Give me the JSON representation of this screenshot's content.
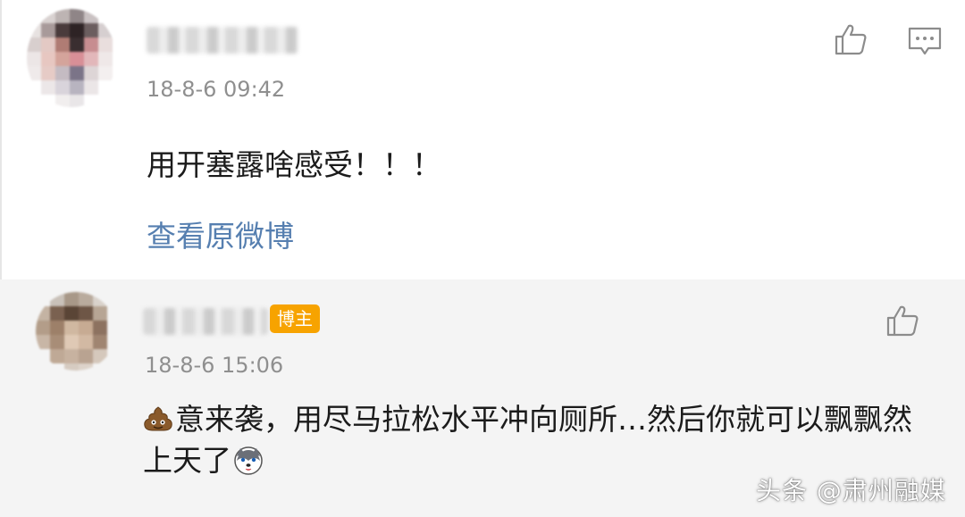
{
  "comments": [
    {
      "timestamp": "18-8-6 09:42",
      "text": "用开塞露啥感受！！！",
      "view_original": "查看原微博"
    },
    {
      "badge": "博主",
      "timestamp": "18-8-6 15:06",
      "text_after_emoji": "意来袭，用尽马拉松水平冲向厕所…然后你就可以飘飘然上天了"
    }
  ],
  "icons": {
    "like": "thumbs-up-icon",
    "reply": "comment-icon",
    "poop": "poop-emoji",
    "husky": "husky-emoji"
  },
  "colors": {
    "link": "#567fb0",
    "badge": "#f7a300",
    "timestamp": "#8f8f8f",
    "text": "#1b1b1b",
    "reply_background": "#f4f4f4"
  },
  "watermark": "头条 @肃州融媒"
}
